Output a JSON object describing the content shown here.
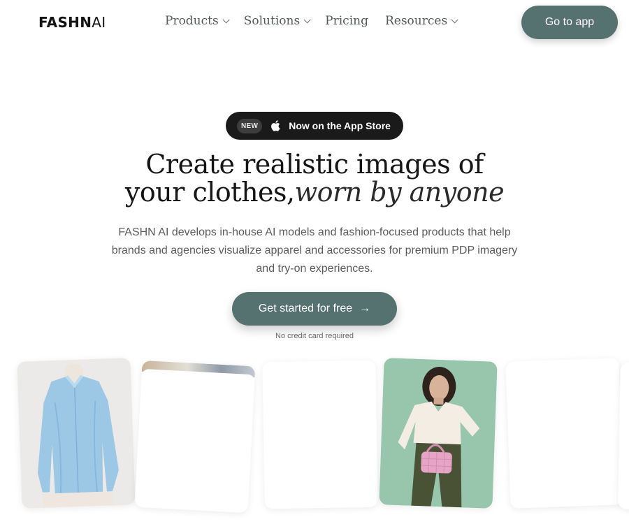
{
  "nav": {
    "logo_bold": "FASHN",
    "logo_light": "AI",
    "items": [
      {
        "label": "Products",
        "dropdown": true
      },
      {
        "label": "Solutions",
        "dropdown": true
      },
      {
        "label": "Pricing",
        "dropdown": false
      },
      {
        "label": "Resources",
        "dropdown": true
      }
    ],
    "cta_label": "Go to app"
  },
  "hero": {
    "badge": {
      "tag": "NEW",
      "icon": "apple-icon",
      "text": "Now on the App Store"
    },
    "headline_line1": "Create realistic images of",
    "headline_line2_regular": "your clothes,",
    "headline_line2_italic": "worn by anyone",
    "description": "FASHN AI develops in-house AI models and fashion-focused products that help brands and agencies visualize apparel and accessories for premium PDP imagery and try-on experiences.",
    "cta_label": "Get started for free",
    "cta_icon": "arrow-right-icon",
    "note": "No credit card required"
  },
  "colors": {
    "accent": "#557170",
    "pill_bg": "#1a1a1a",
    "text_dark": "#151515",
    "text_muted": "#5c5c5c"
  },
  "gallery": {
    "cards": [
      {
        "content": "blue silk blouse on mannequin"
      },
      {
        "content": "outdoor scene photo (partially loaded)"
      },
      {
        "content": "blank"
      },
      {
        "content": "model in cream blouse with pink bag"
      },
      {
        "content": "blank"
      },
      {
        "content": "blank"
      }
    ]
  }
}
